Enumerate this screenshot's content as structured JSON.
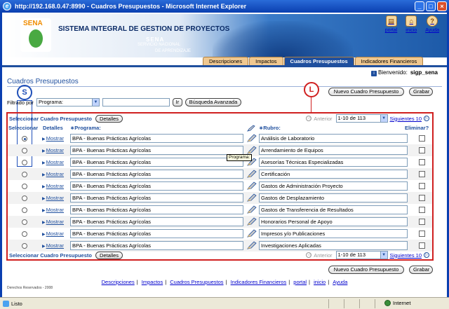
{
  "window": {
    "title": "http://192.168.0.47:8990 - Cuadros Presupuestos - Microsoft Internet Explorer",
    "minimize_glyph": "_",
    "maximize_glyph": "□",
    "close_glyph": "×"
  },
  "banner": {
    "logo_text": "SENA",
    "title": "SISTEMA INTEGRAL DE GESTION DE PROYECTOS",
    "org_name": "SENA",
    "org_line1": "SERVICIO NACIONAL",
    "org_line2": "DE APRENDIZAJE"
  },
  "top_links": [
    {
      "label": "portal",
      "icon": "portal-icon",
      "glyph": "▤"
    },
    {
      "label": "inicio",
      "icon": "home-icon",
      "glyph": "⌂"
    },
    {
      "label": "Ayuda",
      "icon": "help-icon",
      "glyph": "?"
    }
  ],
  "tabs": [
    {
      "label": "Descripciones",
      "active": false
    },
    {
      "label": "Impactos",
      "active": false
    },
    {
      "label": "Cuadros Presupuestos",
      "active": true
    },
    {
      "label": "Indicadores Financieros",
      "active": false
    }
  ],
  "user": {
    "info_glyph": "i",
    "welcome": "Bienvenido:",
    "username": "sigp_sena"
  },
  "page": {
    "title": "Cuadros Presupuestos",
    "new_button": "Nuevo Cuadro Presupuesto",
    "save_button": "Grabar"
  },
  "filter": {
    "label": "Filtrado por",
    "field": "Programa:",
    "go_button": "Ir",
    "advanced_button": "Búsqueda Avanzada",
    "value": ""
  },
  "pager": {
    "select_label": "Seleccionar Cuadro Presupuesto",
    "details_button": "Detalles",
    "previous": "Anterior",
    "range": "1-10 de 113",
    "next": "Siguientes 10",
    "prev_glyph": "◁",
    "next_glyph": "▷",
    "dropdown_glyph": "▼"
  },
  "columns": {
    "select": "Seleccionar",
    "details": "Detalles",
    "programa": "∗Programa:",
    "rubro": "∗Rubro:",
    "delete": "Eliminar?"
  },
  "rows": [
    {
      "show": "Mostrar",
      "programa": "BPA - Buenas Prácticas Agrícolas",
      "rubro": "Análisis de Laboratorio",
      "selected": true
    },
    {
      "show": "Mostrar",
      "programa": "BPA - Buenas Prácticas Agrícolas",
      "rubro": "Arrendamiento de Equipos",
      "selected": false
    },
    {
      "show": "Mostrar",
      "programa": "BPA - Buenas Prácticas Agrícolas",
      "rubro": "Asesorías Técnicas Especializadas",
      "selected": false
    },
    {
      "show": "Mostrar",
      "programa": "BPA - Buenas Prácticas Agrícolas",
      "rubro": "Certificación",
      "selected": false
    },
    {
      "show": "Mostrar",
      "programa": "BPA - Buenas Prácticas Agrícolas",
      "rubro": "Gastos de Administración Proyecto",
      "selected": false
    },
    {
      "show": "Mostrar",
      "programa": "BPA - Buenas Prácticas Agrícolas",
      "rubro": "Gastos de Desplazamiento",
      "selected": false
    },
    {
      "show": "Mostrar",
      "programa": "BPA - Buenas Prácticas Agrícolas",
      "rubro": "Gastos de Transferencia de Resultados",
      "selected": false
    },
    {
      "show": "Mostrar",
      "programa": "BPA - Buenas Prácticas Agrícolas",
      "rubro": "Honorarios Personal de Apoyo",
      "selected": false
    },
    {
      "show": "Mostrar",
      "programa": "BPA - Buenas Prácticas Agrícolas",
      "rubro": "Impresos y/o Publicaciones",
      "selected": false
    },
    {
      "show": "Mostrar",
      "programa": "BPA - Buenas Prácticas Agrícolas",
      "rubro": "Investigaciones Aplicadas",
      "selected": false
    }
  ],
  "tooltip": "Programa:",
  "annotations": {
    "s": "S",
    "l": "L"
  },
  "footer": {
    "links": [
      "Descripciones",
      "Impactos",
      "Cuadros Presupuestos",
      "Indicadores Financieros",
      "portal",
      "inicio",
      "Ayuda"
    ],
    "separator": "|",
    "copyright": "Derechos Reservados - 2008"
  },
  "status": {
    "text": "Listo",
    "zone": "Internet"
  }
}
